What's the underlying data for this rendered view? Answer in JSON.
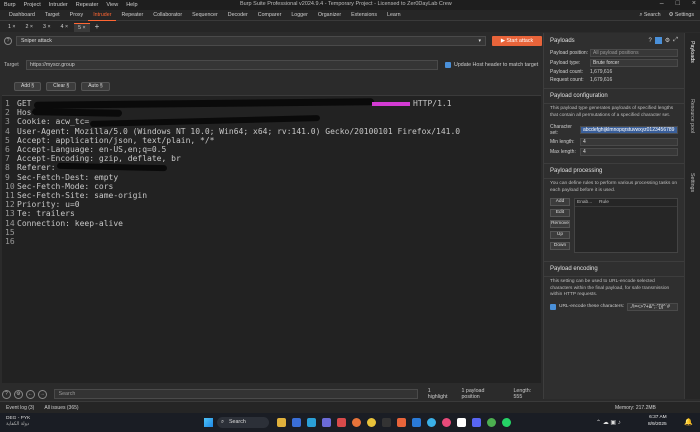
{
  "titlebar": {
    "menu": [
      "Burp",
      "Project",
      "Intruder",
      "Repeater",
      "View",
      "Help"
    ],
    "title": "Burp Suite Professional v2024.9.4 - Temporary Project - Licensed to Zer0DayLab Crew"
  },
  "nav": {
    "tabs": [
      "Dashboard",
      "Target",
      "Proxy",
      "Intruder",
      "Repeater",
      "Collaborator",
      "Sequencer",
      "Decoder",
      "Comparer",
      "Logger",
      "Organizer",
      "Extensions",
      "Learn"
    ],
    "active": "Intruder",
    "search_label": "Search",
    "settings_label": "Settings"
  },
  "subtabs": [
    "1 ×",
    "2 ×",
    "3 ×",
    "4 ×",
    "5 ×"
  ],
  "attack": {
    "type": "Sniper attack",
    "start_label": "Start attack",
    "target_label": "Target",
    "target_value": "https://myscr.group",
    "update_host_label": "Update Host header to match target"
  },
  "editor_buttons": [
    "Add §",
    "Clear §",
    "Auto §"
  ],
  "request_lines": [
    {
      "no": "1",
      "text": "GET",
      "tail": "HTTP/1.1"
    },
    {
      "no": "2",
      "text": "Host:"
    },
    {
      "no": "3",
      "text": "Cookie: acw_tc="
    },
    {
      "no": "4",
      "text": "User-Agent: Mozilla/5.0 (Windows NT 10.0; Win64; x64; rv:141.0) Gecko/20100101 Firefox/141.0"
    },
    {
      "no": "5",
      "text": "Accept: application/json, text/plain, */*"
    },
    {
      "no": "6",
      "text": "Accept-Language: en-US,en;q=0.5"
    },
    {
      "no": "7",
      "text": "Accept-Encoding: gzip, deflate, br"
    },
    {
      "no": "8",
      "text": "Referer:"
    },
    {
      "no": "9",
      "text": "Sec-Fetch-Dest: empty"
    },
    {
      "no": "10",
      "text": "Sec-Fetch-Mode: cors"
    },
    {
      "no": "11",
      "text": "Sec-Fetch-Site: same-origin"
    },
    {
      "no": "12",
      "text": "Priority: u=0"
    },
    {
      "no": "13",
      "text": "Te: trailers"
    },
    {
      "no": "14",
      "text": "Connection: keep-alive"
    },
    {
      "no": "15",
      "text": ""
    },
    {
      "no": "16",
      "text": ""
    }
  ],
  "bottom": {
    "search_placeholder": "Search",
    "highlight": "1 highlight",
    "positions": "1 payload position",
    "length": "Length: 555"
  },
  "payloads": {
    "header": "Payloads",
    "position_label": "Payload position:",
    "position_value": "All payload positions",
    "type_label": "Payload type:",
    "type_value": "Brute forcer",
    "count_label": "Payload count:",
    "count_value": "1,679,616",
    "request_label": "Request count:",
    "request_value": "1,679,616",
    "config_header": "Payload configuration",
    "config_desc": "This payload type generates payloads of specified lengths that contain all permutations of a specified character set.",
    "charset_label": "Character set:",
    "charset_value": "abcdefghijklmnopqrstuvwxyz0123456789",
    "min_label": "Min length:",
    "min_value": "4",
    "max_label": "Max length:",
    "max_value": "4",
    "processing_header": "Payload processing",
    "processing_desc": "You can define rules to perform various processing tasks on each payload before it is used.",
    "processing_buttons": [
      "Add",
      "Edit",
      "Remove",
      "Up",
      "Down"
    ],
    "rule_col_enabled": "Enab...",
    "rule_col_rule": "Rule",
    "encoding_header": "Payload encoding",
    "encoding_desc": "This setting can be used to URL-encode selected characters within the final payload, for safe transmission within HTTP requests.",
    "encode_label": "URL-encode these characters:",
    "encode_value": "./\\=<>?+&*;:\"{}|^`#"
  },
  "rail": [
    "Payloads",
    "Resource pool",
    "Settings"
  ],
  "eventbar": {
    "event_log": "Event log (3)",
    "issues": "All issues (365)",
    "memory": "Memory: 217.2MB"
  },
  "taskbar": {
    "weather_temp": "DEG - PYK",
    "weather_sub": "دولة الكفاية",
    "search": "Search",
    "time": "6:37 AM",
    "date": "8/9/2025",
    "colors": {
      "accent": "#ff6633",
      "start": "#e8643a",
      "link": "#4a90d9"
    }
  }
}
